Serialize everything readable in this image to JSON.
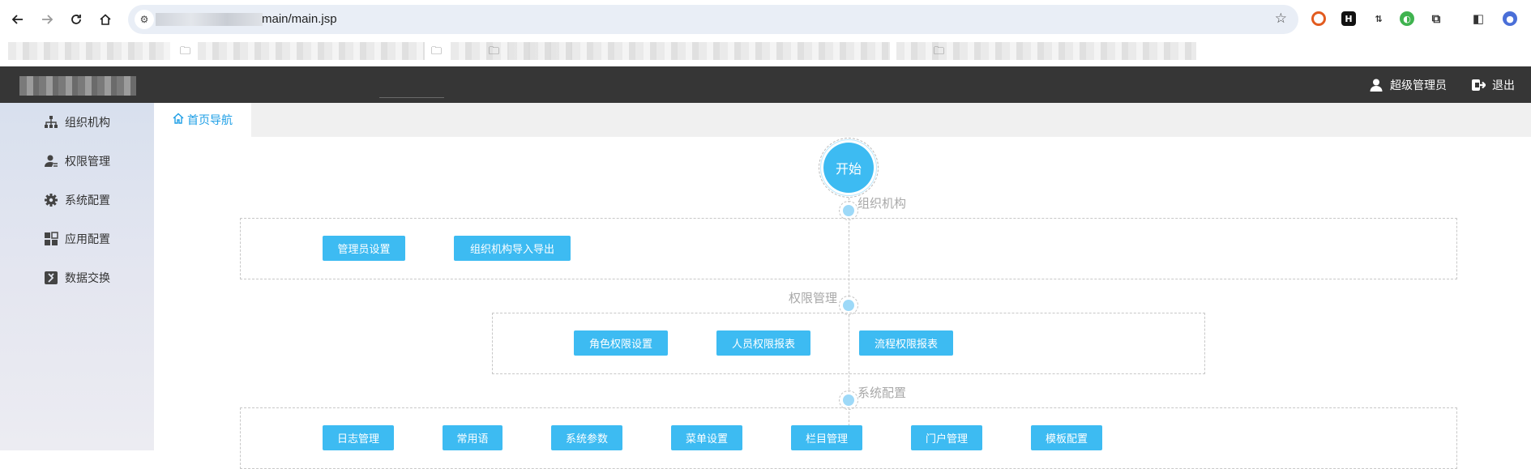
{
  "browser": {
    "url_visible": "main/main.jsp",
    "icons": [
      "back-icon",
      "forward-icon",
      "reload-icon",
      "home-icon",
      "site-info-icon",
      "star-icon",
      "extensions-icon",
      "side-panel-icon",
      "profile-icon"
    ]
  },
  "header": {
    "user_label": "超级管理员",
    "logout_label": "退出"
  },
  "sidebar": {
    "items": [
      {
        "label": "组织机构",
        "icon": "org-chart-icon"
      },
      {
        "label": "权限管理",
        "icon": "user-permission-icon"
      },
      {
        "label": "系统配置",
        "icon": "gear-icon"
      },
      {
        "label": "应用配置",
        "icon": "apps-grid-icon"
      },
      {
        "label": "数据交换",
        "icon": "exchange-icon"
      }
    ]
  },
  "tabs": {
    "active": {
      "label": "首页导航",
      "icon": "home-icon"
    }
  },
  "flow": {
    "start_label": "开始",
    "sections": [
      {
        "label": "组织机构",
        "buttons": [
          "管理员设置",
          "组织机构导入导出"
        ]
      },
      {
        "label": "权限管理",
        "buttons": [
          "角色权限设置",
          "人员权限报表",
          "流程权限报表"
        ]
      },
      {
        "label": "系统配置",
        "buttons": [
          "日志管理",
          "常用语",
          "系统参数",
          "菜单设置",
          "栏目管理",
          "门户管理",
          "模板配置"
        ]
      }
    ]
  },
  "colors": {
    "header_bg": "#363636",
    "accent": "#3dbbf2",
    "tab_active_text": "#1e9fe6",
    "sidebar_bg": "#dde3ef"
  }
}
